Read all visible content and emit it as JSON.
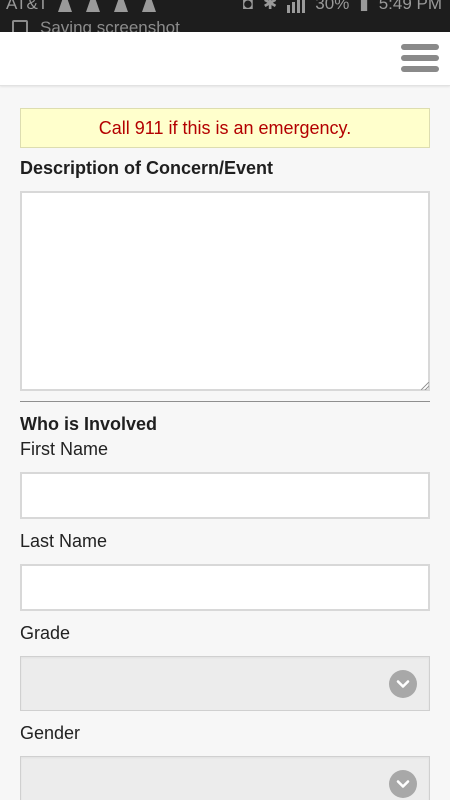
{
  "status_bar": {
    "carrier": "AT&T",
    "battery": "30%",
    "time": "5:49 PM",
    "notification": "Saving screenshot"
  },
  "header": {
    "menu_icon": "hamburger-menu-icon"
  },
  "alert": {
    "text": "Call 911 if this is an emergency.",
    "color": "#b30000",
    "background": "#ffffcc"
  },
  "form": {
    "description_label": "Description of Concern/Event",
    "description_value": "",
    "involved_heading": "Who is Involved",
    "first_name_label": "First Name",
    "first_name_value": "",
    "last_name_label": "Last Name",
    "last_name_value": "",
    "grade_label": "Grade",
    "grade_selected": "",
    "gender_label": "Gender",
    "gender_selected": ""
  }
}
